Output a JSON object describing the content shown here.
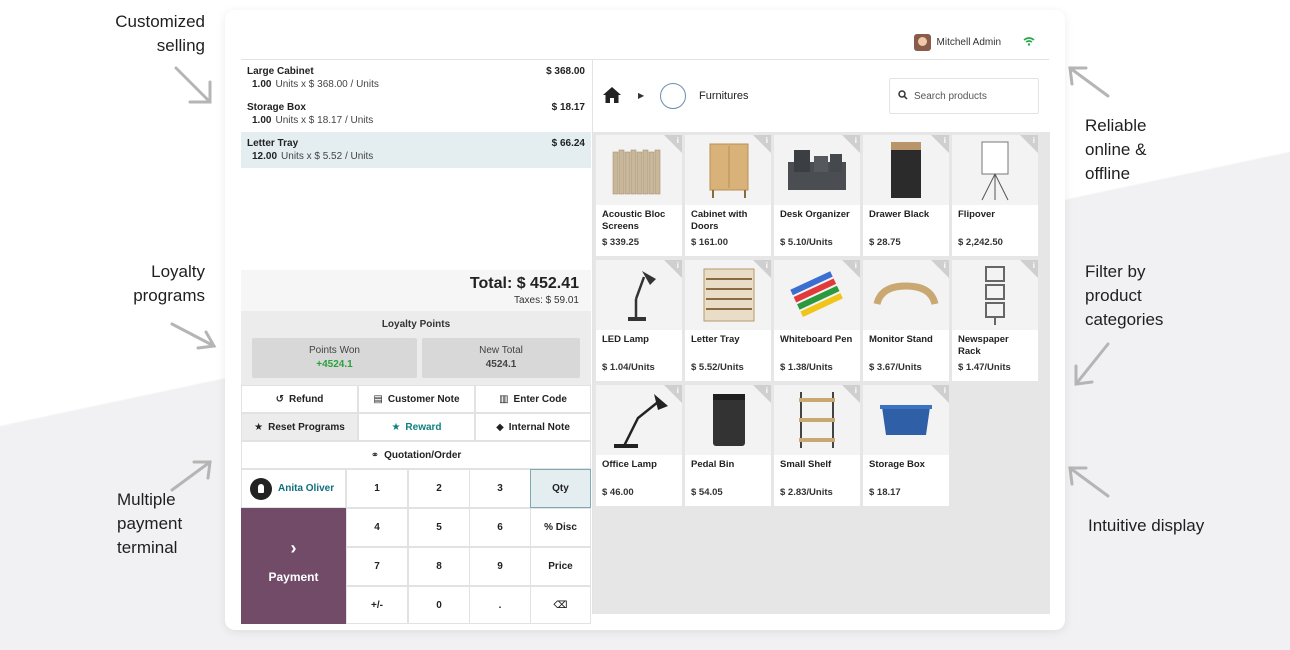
{
  "features": {
    "customized": "Customized\nselling",
    "loyalty": "Loyalty\nprograms",
    "multiple": "Multiple\npayment\nterminal",
    "reliable": "Reliable\nonline &\noffline",
    "filter": "Filter by\nproduct\ncategories",
    "intuitive": "Intuitive display"
  },
  "topbar": {
    "user_name": "Mitchell Admin"
  },
  "order": {
    "lines": [
      {
        "name": "Large Cabinet",
        "qty": "1.00",
        "detail": "Units x $ 368.00 / Units",
        "price": "$ 368.00"
      },
      {
        "name": "Storage Box",
        "qty": "1.00",
        "detail": "Units x $ 18.17 / Units",
        "price": "$ 18.17"
      },
      {
        "name": "Letter Tray",
        "qty": "12.00",
        "detail": "Units x $ 5.52 / Units",
        "price": "$ 66.24"
      }
    ],
    "total": "Total: $ 452.41",
    "taxes": "Taxes: $ 59.01"
  },
  "loyalty": {
    "title": "Loyalty Points",
    "won_label": "Points Won",
    "won_value": "+4524.1",
    "new_label": "New Total",
    "new_value": "4524.1"
  },
  "controls": {
    "refund": "Refund",
    "customer_note": "Customer Note",
    "enter_code": "Enter Code",
    "reset_programs": "Reset Programs",
    "reward": "Reward",
    "internal_note": "Internal Note",
    "quotation": "Quotation/Order"
  },
  "numpad": {
    "customer": "Anita Oliver",
    "payment": "Payment",
    "keys": [
      "1",
      "2",
      "3",
      "Qty",
      "4",
      "5",
      "6",
      "% Disc",
      "7",
      "8",
      "9",
      "Price",
      "+/-",
      "0",
      ".",
      "⌫"
    ]
  },
  "catalog": {
    "category": "Furnitures",
    "search_placeholder": "Search products",
    "products": [
      {
        "name": "Acoustic Bloc Screens",
        "price": "$ 339.25"
      },
      {
        "name": "Cabinet with Doors",
        "price": "$ 161.00"
      },
      {
        "name": "Desk Organizer",
        "price": "$ 5.10/Units"
      },
      {
        "name": "Drawer Black",
        "price": "$ 28.75"
      },
      {
        "name": "Flipover",
        "price": "$ 2,242.50"
      },
      {
        "name": "LED Lamp",
        "price": "$ 1.04/Units"
      },
      {
        "name": "Letter Tray",
        "price": "$ 5.52/Units"
      },
      {
        "name": "Whiteboard Pen",
        "price": "$ 1.38/Units"
      },
      {
        "name": "Monitor Stand",
        "price": "$ 3.67/Units"
      },
      {
        "name": "Newspaper Rack",
        "price": "$ 1.47/Units"
      },
      {
        "name": "Office Lamp",
        "price": "$ 46.00"
      },
      {
        "name": "Pedal Bin",
        "price": "$ 54.05"
      },
      {
        "name": "Small Shelf",
        "price": "$ 2.83/Units"
      },
      {
        "name": "Storage Box",
        "price": "$ 18.17"
      }
    ]
  },
  "colors": {
    "accent": "#714b67",
    "selected_line": "#e4eef1",
    "points_won": "#29a23c",
    "link_teal": "#0f7f7f",
    "wifi": "#2ea84f"
  },
  "icons": [
    "home-icon",
    "search-icon",
    "wifi-icon",
    "refund-icon",
    "note-icon",
    "barcode-icon",
    "star-icon",
    "tag-icon",
    "link-icon",
    "user-icon",
    "chevron-right-icon",
    "backspace-icon",
    "info-icon"
  ]
}
